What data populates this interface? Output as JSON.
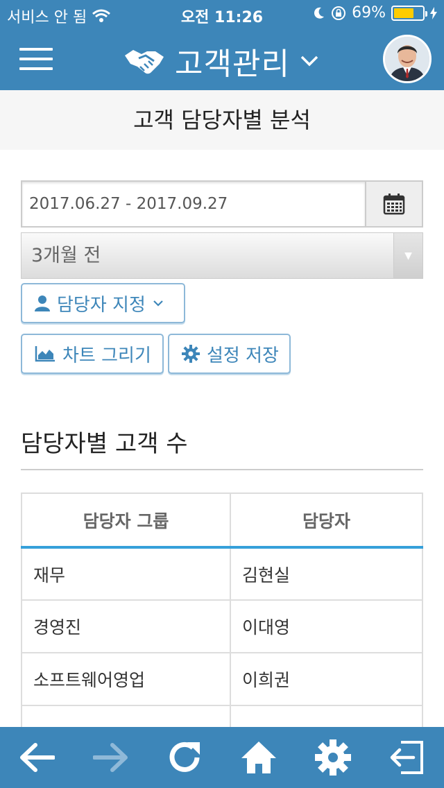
{
  "status_bar": {
    "carrier": "서비스 안 됨",
    "time": "오전 11:26",
    "battery": "69%",
    "battery_level": 0.69
  },
  "header": {
    "app_title": "고객관리",
    "icons": {
      "menu": "hamburger-icon",
      "logo": "handshake-icon",
      "dropdown": "chevron-down-icon"
    }
  },
  "page": {
    "title": "고객 담당자별 분석"
  },
  "filters": {
    "date_range": "2017.06.27 - 2017.09.27",
    "period": "3개월 전",
    "assign_label": "담당자 지정",
    "draw_chart_label": "차트 그리기",
    "save_settings_label": "설정 저장"
  },
  "section": {
    "title": "담당자별 고객 수"
  },
  "table": {
    "headers": [
      "담당자 그룹",
      "담당자"
    ],
    "rows": [
      [
        "재무",
        "김현실"
      ],
      [
        "경영진",
        "이대영"
      ],
      [
        "소프트웨어영업",
        "이희권"
      ]
    ]
  },
  "colors": {
    "primary": "#3d86b9",
    "accent_border": "#35a0da",
    "battery": "#ffcc00"
  }
}
